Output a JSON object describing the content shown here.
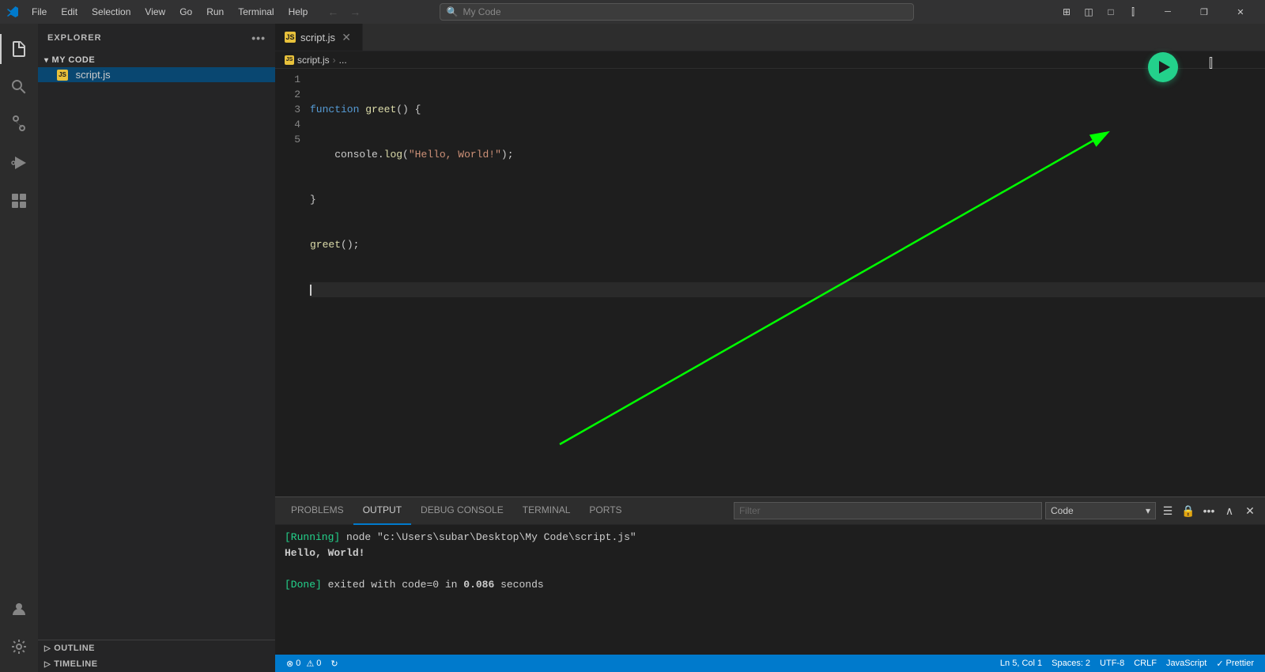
{
  "titlebar": {
    "icon": "⬡",
    "menus": [
      "File",
      "Edit",
      "Selection",
      "View",
      "Go",
      "Run",
      "Terminal",
      "Help"
    ],
    "search_placeholder": "My Code",
    "nav_back": "←",
    "nav_forward": "→",
    "win_minimize": "─",
    "win_restore": "❐",
    "win_close": "✕"
  },
  "activity_bar": {
    "items": [
      {
        "name": "explorer",
        "icon": "⧉",
        "active": true
      },
      {
        "name": "search",
        "icon": "🔍"
      },
      {
        "name": "source-control",
        "icon": "⎇"
      },
      {
        "name": "run-debug",
        "icon": "▷"
      },
      {
        "name": "extensions",
        "icon": "⧄"
      }
    ],
    "bottom_items": [
      {
        "name": "accounts",
        "icon": "○"
      },
      {
        "name": "settings",
        "icon": "⚙"
      }
    ]
  },
  "sidebar": {
    "title": "EXPLORER",
    "overflow_icon": "•••",
    "folder": {
      "name": "MY CODE",
      "expanded": true,
      "files": [
        {
          "name": "script.js",
          "icon": "JS",
          "active": true
        }
      ]
    },
    "outline_label": "OUTLINE",
    "timeline_label": "TIMELINE"
  },
  "tabs": [
    {
      "name": "script.js",
      "icon": "JS",
      "active": true,
      "dirty": false
    }
  ],
  "breadcrumb": {
    "parts": [
      "script.js",
      "..."
    ]
  },
  "code": {
    "lines": [
      {
        "num": 1,
        "content": "function greet() {",
        "tokens": [
          {
            "type": "kw",
            "text": "function"
          },
          {
            "type": "sp",
            "text": " "
          },
          {
            "type": "fn",
            "text": "greet"
          },
          {
            "type": "punc",
            "text": "() {"
          }
        ]
      },
      {
        "num": 2,
        "content": "    console.log(\"Hello, World!\");",
        "tokens": [
          {
            "type": "sp",
            "text": "    "
          },
          {
            "type": "plain",
            "text": "console."
          },
          {
            "type": "fn",
            "text": "log"
          },
          {
            "type": "punc",
            "text": "("
          },
          {
            "type": "str",
            "text": "\"Hello, World!\""
          },
          {
            "type": "punc",
            "text": ");"
          }
        ]
      },
      {
        "num": 3,
        "content": "}",
        "tokens": [
          {
            "type": "punc",
            "text": "}"
          }
        ]
      },
      {
        "num": 4,
        "content": "greet();",
        "tokens": [
          {
            "type": "fn",
            "text": "greet"
          },
          {
            "type": "punc",
            "text": "();"
          }
        ]
      },
      {
        "num": 5,
        "content": "",
        "cursor": true
      }
    ]
  },
  "run_button": {
    "label": "Run Code",
    "visible": true
  },
  "panel": {
    "tabs": [
      "PROBLEMS",
      "OUTPUT",
      "DEBUG CONSOLE",
      "TERMINAL",
      "PORTS"
    ],
    "active_tab": "OUTPUT",
    "filter_placeholder": "Filter",
    "dropdown_label": "Code",
    "output": {
      "line1": "[Running] node \"c:\\Users\\subar\\Desktop\\My Code\\script.js\"",
      "line2": "Hello, World!",
      "line3": "",
      "line4": "[Done] exited with code=0 in 0.086 seconds"
    }
  },
  "status_bar": {
    "git_branch": "⓪ 0  ⚠ 0",
    "sync": "↻",
    "ln_col": "Ln 5, Col 1",
    "spaces": "Spaces: 2",
    "encoding": "UTF-8",
    "line_ending": "CRLF",
    "language": "JavaScript",
    "prettier": "Prettier",
    "errors_icon": "⊗",
    "warnings_icon": "⚠"
  }
}
